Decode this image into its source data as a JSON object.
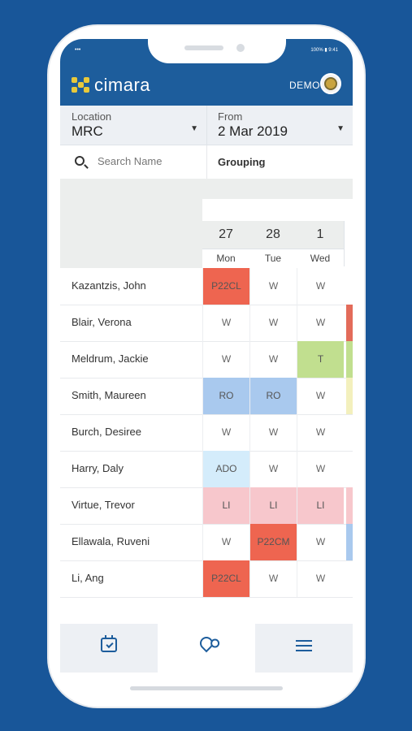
{
  "status": {
    "left": "•••",
    "right": "100% ▮ 9:41"
  },
  "app": {
    "brand": "cimara",
    "user_label": "DEMO"
  },
  "filters": {
    "location": {
      "label": "Location",
      "value": "MRC"
    },
    "from": {
      "label": "From",
      "value": "2 Mar 2019"
    }
  },
  "search": {
    "placeholder": "Search Name"
  },
  "grouping": {
    "label": "Grouping"
  },
  "columns": [
    {
      "day": "27",
      "dow": "Mon"
    },
    {
      "day": "28",
      "dow": "Tue"
    },
    {
      "day": "1",
      "dow": "Wed"
    }
  ],
  "rows": [
    {
      "name": "Kazantzis, John",
      "cells": [
        {
          "text": "P22CL",
          "color": "#ee6550"
        },
        {
          "text": "W",
          "color": ""
        },
        {
          "text": "W",
          "color": ""
        }
      ],
      "edge": ""
    },
    {
      "name": "Blair, Verona",
      "cells": [
        {
          "text": "W",
          "color": ""
        },
        {
          "text": "W",
          "color": ""
        },
        {
          "text": "W",
          "color": ""
        }
      ],
      "edge": "#e36b5a"
    },
    {
      "name": "Meldrum, Jackie",
      "cells": [
        {
          "text": "W",
          "color": ""
        },
        {
          "text": "W",
          "color": ""
        },
        {
          "text": "T",
          "color": "#c1df8f"
        }
      ],
      "edge": "#c1df8f"
    },
    {
      "name": "Smith, Maureen",
      "cells": [
        {
          "text": "RO",
          "color": "#a9c9ee"
        },
        {
          "text": "RO",
          "color": "#a9c9ee"
        },
        {
          "text": "W",
          "color": ""
        }
      ],
      "edge": "#f3f0bd"
    },
    {
      "name": "Burch, Desiree",
      "cells": [
        {
          "text": "W",
          "color": ""
        },
        {
          "text": "W",
          "color": ""
        },
        {
          "text": "W",
          "color": ""
        }
      ],
      "edge": ""
    },
    {
      "name": "Harry, Daly",
      "cells": [
        {
          "text": "ADO",
          "color": "#d4ecfb"
        },
        {
          "text": "W",
          "color": ""
        },
        {
          "text": "W",
          "color": ""
        }
      ],
      "edge": ""
    },
    {
      "name": "Virtue, Trevor",
      "cells": [
        {
          "text": "LI",
          "color": "#f7c7cc"
        },
        {
          "text": "LI",
          "color": "#f7c7cc"
        },
        {
          "text": "LI",
          "color": "#f7c7cc"
        }
      ],
      "edge": "#f7c7cc"
    },
    {
      "name": "Ellawala, Ruveni",
      "cells": [
        {
          "text": "W",
          "color": ""
        },
        {
          "text": "P22CM",
          "color": "#ee6550"
        },
        {
          "text": "W",
          "color": ""
        }
      ],
      "edge": "#a9c9ee"
    },
    {
      "name": "Li, Ang",
      "cells": [
        {
          "text": "P22CL",
          "color": "#ee6550"
        },
        {
          "text": "W",
          "color": ""
        },
        {
          "text": "W",
          "color": ""
        }
      ],
      "edge": ""
    }
  ],
  "tabs": [
    "calendar-check-icon",
    "location-search-icon",
    "menu-icon"
  ],
  "colors": {
    "brand": "#1d5d9c",
    "accent": "#e8c93b",
    "background": "#185699"
  }
}
